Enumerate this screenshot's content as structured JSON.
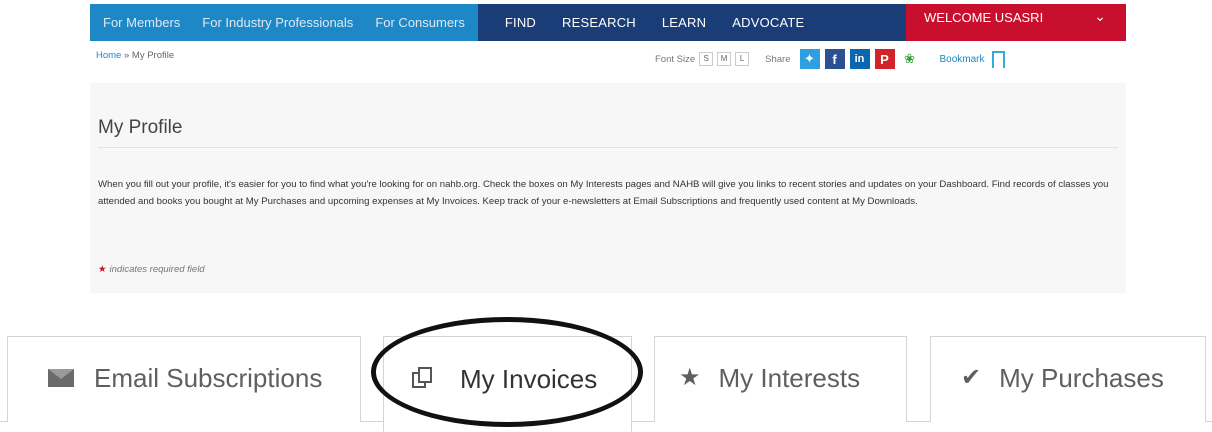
{
  "nav": {
    "audience_links": [
      "For Members",
      "For Industry Professionals",
      "For Consumers"
    ],
    "main_links": [
      "FIND",
      "RESEARCH",
      "LEARN",
      "ADVOCATE"
    ],
    "welcome": "WELCOME USASRI",
    "colors": {
      "navy": "#1a3d78",
      "audience_bar": "#1e88c7",
      "welcome_bg": "#c8102e"
    }
  },
  "breadcrumb": {
    "home": "Home",
    "separator": " » ",
    "current": "My Profile"
  },
  "tools": {
    "font_size_label": "Font Size",
    "font_sizes": [
      "S",
      "M",
      "L"
    ],
    "share_label": "Share",
    "social_icons": [
      "twitter-icon",
      "facebook-icon",
      "linkedin-icon",
      "pinterest-icon",
      "spark-icon"
    ],
    "bookmark_label": "Bookmark"
  },
  "main": {
    "title": "My Profile",
    "intro": "When you fill out your profile, it's easier for you to find what you're looking for on nahb.org. Check the boxes on My Interests pages and NAHB will give you links to recent stories and updates on your Dashboard. Find records of classes you attended and books you bought at My Purchases and upcoming expenses at My Invoices. Keep track of your e-newsletters at Email Subscriptions and frequently used content at My Downloads.",
    "required_note": "indicates required field"
  },
  "tabs": [
    {
      "label": "Email Subscriptions",
      "icon": "envelope-icon"
    },
    {
      "label": "My Invoices",
      "icon": "copy-icon",
      "active": true
    },
    {
      "label": "My Interests",
      "icon": "star-icon"
    },
    {
      "label": "My Purchases",
      "icon": "checkmark-icon"
    }
  ]
}
